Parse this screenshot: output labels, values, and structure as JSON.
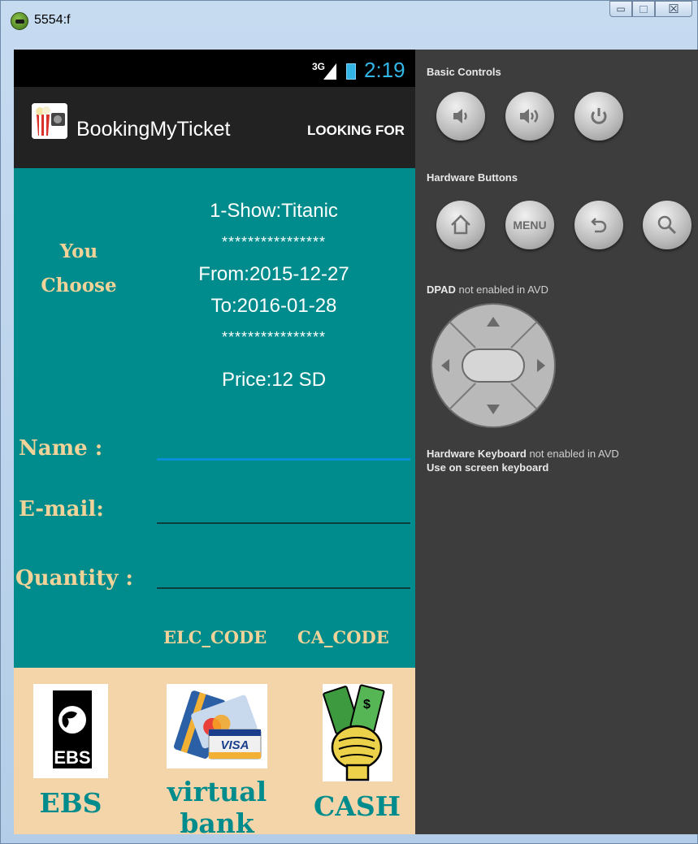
{
  "window": {
    "title": "5554:f",
    "controls": [
      "minimize",
      "maximize",
      "close"
    ]
  },
  "statusbar": {
    "network": "3G",
    "time": "2:19"
  },
  "actionbar": {
    "app_name": "BookingMyTicket",
    "action": "LOOKING FOR"
  },
  "selection": {
    "heading_line1": "You",
    "heading_line2": "Choose",
    "show": "1-Show:Titanic",
    "separator": "****************",
    "from": "From:2015-12-27",
    "to": "To:2016-01-28",
    "price": "Price:12 SD"
  },
  "form": {
    "name_label": "Name :",
    "email_label": "E-mail:",
    "quantity_label": "Quantity :",
    "name_value": "",
    "email_value": "",
    "quantity_value": ""
  },
  "codes": {
    "elc": "ELC_CODE",
    "ca": "CA_CODE"
  },
  "payment": {
    "ebs_label": "EBS",
    "ebs_logo_text": "EBS",
    "virtual_label": "virtual bank",
    "visa_text": "VISA",
    "cash_label": "CASH"
  },
  "panel": {
    "basic_controls": "Basic Controls",
    "hardware_buttons": "Hardware Buttons",
    "dpad_bold": "DPAD",
    "dpad_note": " not enabled in AVD",
    "keyboard_bold": "Hardware Keyboard",
    "keyboard_note": " not enabled in AVD",
    "keyboard_hint": "Use on screen keyboard",
    "menu_label": "MENU"
  },
  "colors": {
    "teal": "#008c8c",
    "gold": "#f1d39a",
    "beige": "#f3d5a9",
    "holo_blue": "#33b5e5",
    "panel_bg": "#3d3d3d"
  }
}
